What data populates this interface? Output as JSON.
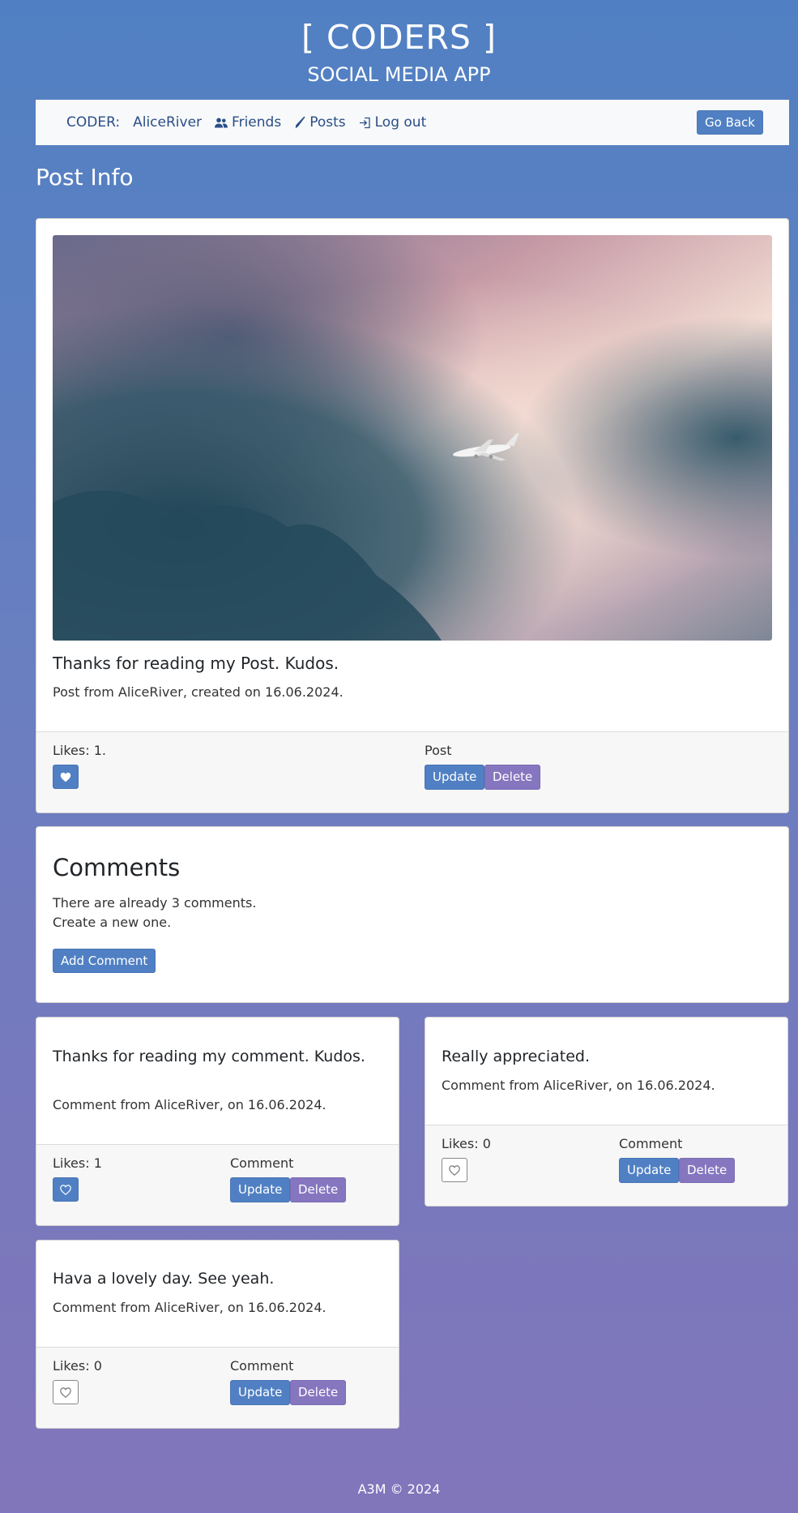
{
  "header": {
    "title": "[ CODERS ]",
    "subtitle": "SOCIAL MEDIA APP"
  },
  "navbar": {
    "coder_label": "CODER:",
    "username": "AliceRiver",
    "friends": "Friends",
    "posts": "Posts",
    "logout": "Log out",
    "go_back": "Go Back"
  },
  "page_title": "Post Info",
  "post": {
    "title": "Thanks for reading my Post. Kudos.",
    "meta": "Post from AliceRiver, created on 16.06.2024.",
    "likes": "Likes: 1.",
    "section_label": "Post",
    "update": "Update",
    "delete": "Delete"
  },
  "comments_section": {
    "title": "Comments",
    "count_text": "There are already 3 comments.",
    "create_text": "Create a new one.",
    "add_button": "Add Comment"
  },
  "comments": [
    {
      "title": "Thanks for reading my comment. Kudos.",
      "meta": "Comment from AliceRiver, on 16.06.2024.",
      "likes": "Likes: 1",
      "label": "Comment",
      "update": "Update",
      "delete": "Delete"
    },
    {
      "title": "Really appreciated.",
      "meta": "Comment from AliceRiver, on 16.06.2024.",
      "likes": "Likes: 0",
      "label": "Comment",
      "update": "Update",
      "delete": "Delete"
    },
    {
      "title": "Hava a lovely day. See yeah.",
      "meta": "Comment from AliceRiver, on 16.06.2024.",
      "likes": "Likes: 0",
      "label": "Comment",
      "update": "Update",
      "delete": "Delete"
    }
  ],
  "footer": {
    "text": "A3M © 2024"
  },
  "colors": {
    "primary": "#5080c3",
    "secondary": "#8576bf",
    "nav_text": "#2a4e87"
  },
  "icons": {
    "friends": "people-icon",
    "posts": "pen-icon",
    "logout": "login-arrow-icon",
    "like": "heart-icon"
  }
}
